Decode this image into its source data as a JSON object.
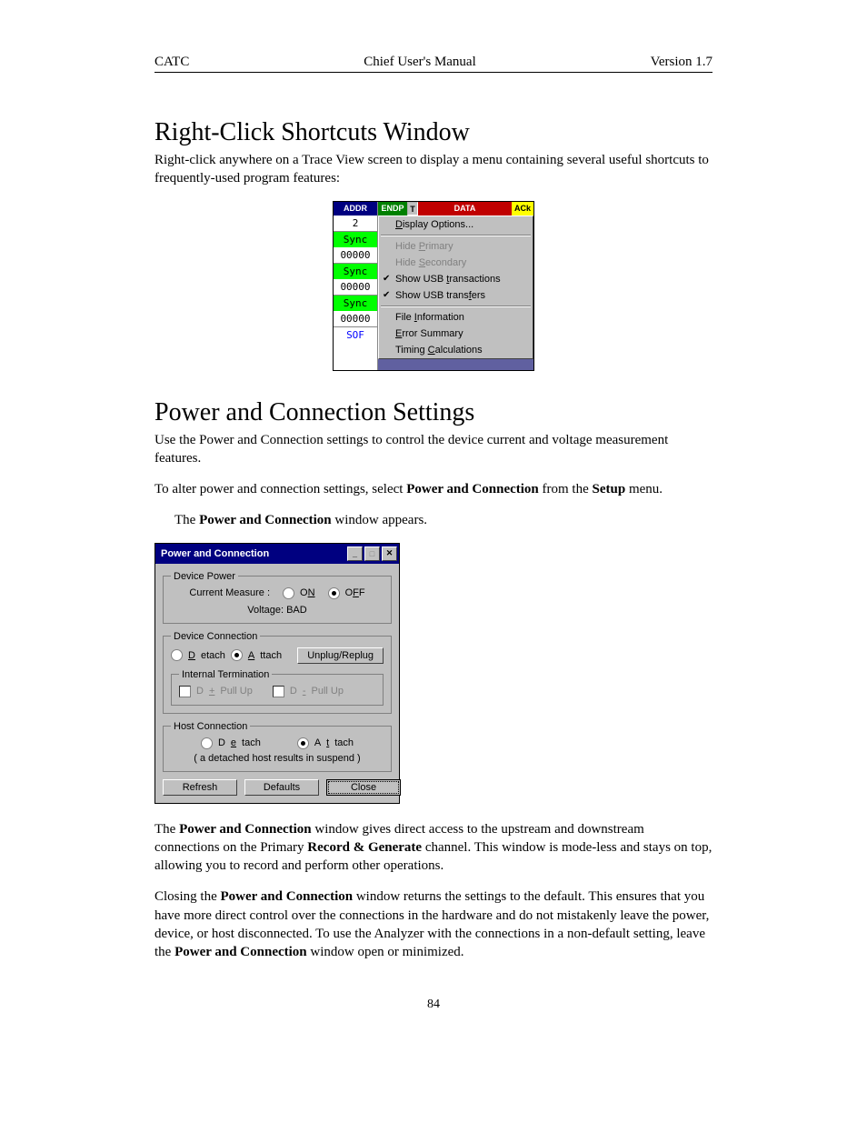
{
  "header": {
    "left": "CATC",
    "center": "Chief User's Manual",
    "right": "Version 1.7"
  },
  "pageNumber": "84",
  "section1": {
    "title": "Right-Click Shortcuts Window",
    "intro": "Right-click anywhere on a Trace View screen to display a menu containing several useful shortcuts to frequently-used program features:"
  },
  "ctxmenu": {
    "leftcol": {
      "addr": "ADDR",
      "val2": "2",
      "sync": "Sync",
      "zeros": "00000",
      "sof": "SOF"
    },
    "hdr": {
      "endp": "ENDP",
      "t": "T",
      "data": "DATA",
      "ack": "ACk"
    },
    "items": {
      "display": "Display Options...",
      "hidePrimary": "Hide Primary",
      "hideSecondary": "Hide Secondary",
      "showTrans": "Show USB transactions",
      "showTransfers": "Show USB transfers",
      "fileInfo": "File Information",
      "errSummary": "Error Summary",
      "timing": "Timing Calculations"
    }
  },
  "section2": {
    "title": "Power and Connection Settings",
    "p1a": "Use the Power and Connection settings to control the device current and voltage measurement features.",
    "p2_pre": "To alter power and connection settings, select ",
    "p2_bold": "Power and Connection",
    "p2_post": " from the ",
    "p2_bold2": "Setup",
    "p2_post2": " menu.",
    "p3_pre": "The ",
    "p3_bold": "Power and Connection",
    "p3_post": " window appears.",
    "p4_pre": "The ",
    "p4_b1": "Power and Connection",
    "p4_mid1": " window gives direct access to the upstream and downstream connections on the Primary ",
    "p4_b2": "Record & Generate",
    "p4_mid2": " channel. This window is mode-less and stays on top, allowing you to record and perform other operations.",
    "p5_pre": "Closing the ",
    "p5_b1": "Power and Connection",
    "p5_mid": " window returns the settings to the default. This ensures that you have more direct control over the connections in the hardware and do not mistakenly leave the power, device, or host disconnected. To use the Analyzer with the connections in a non-default setting, leave the ",
    "p5_b2": "Power and Connection",
    "p5_post": " window open or minimized."
  },
  "dialog": {
    "title": "Power and Connection",
    "grp1": {
      "legend": "Device Power",
      "current": "Current Measure :",
      "on": "ON",
      "off": "OFF",
      "voltage": "Voltage: BAD"
    },
    "grp2": {
      "legend": "Device Connection",
      "detach": "Detach",
      "attach": "Attach",
      "unplug": "Unplug/Replug",
      "termLegend": "Internal Termination",
      "dplus": "D+ Pull Up",
      "dminus": "D- Pull Up"
    },
    "grp3": {
      "legend": "Host Connection",
      "detach": "Detach",
      "attach": "Attach",
      "note": "( a detached host results in suspend )"
    },
    "buttons": {
      "refresh": "Refresh",
      "defaults": "Defaults",
      "close": "Close"
    }
  }
}
